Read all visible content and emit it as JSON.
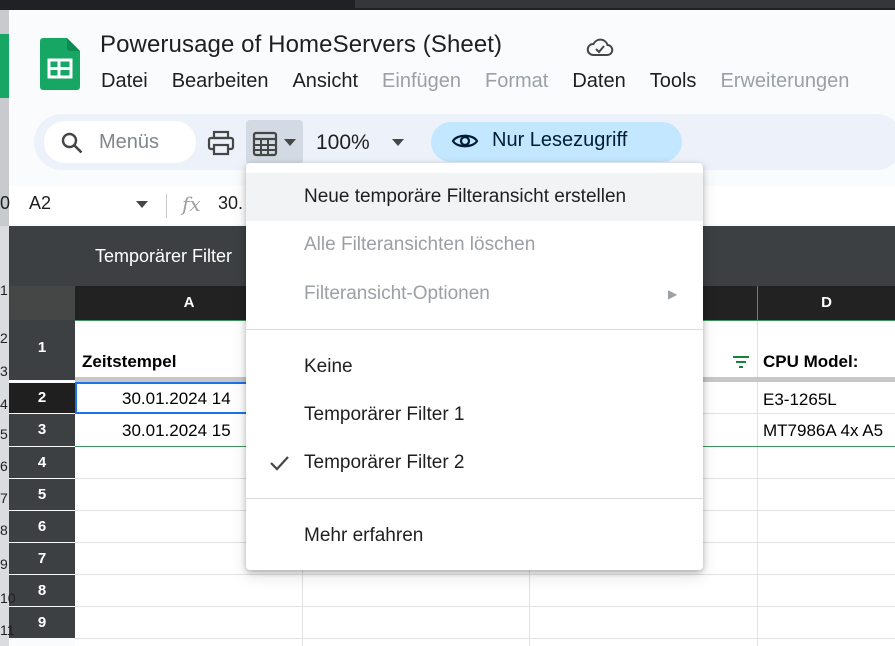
{
  "document": {
    "title": "Powerusage of HomeServers (Sheet)"
  },
  "menu_bar": [
    {
      "label": "Datei",
      "enabled": true
    },
    {
      "label": "Bearbeiten",
      "enabled": true
    },
    {
      "label": "Ansicht",
      "enabled": true
    },
    {
      "label": "Einfügen",
      "enabled": false
    },
    {
      "label": "Format",
      "enabled": false
    },
    {
      "label": "Daten",
      "enabled": true
    },
    {
      "label": "Tools",
      "enabled": true
    },
    {
      "label": "Erweiterungen",
      "enabled": false
    }
  ],
  "toolbar": {
    "search_placeholder": "Menüs",
    "zoom": "100%",
    "readonly_label": "Nur Lesezugriff"
  },
  "formula_bar": {
    "left_digit": "0",
    "cell_ref": "A2",
    "fx": "fx",
    "content": "30."
  },
  "filter_band": {
    "label": "Temporärer Filter"
  },
  "grid": {
    "columns": [
      "A",
      "D"
    ],
    "rows": [
      "1",
      "2",
      "3",
      "4",
      "5",
      "6",
      "7",
      "8",
      "9"
    ],
    "left_sliver_digits": [
      "1",
      "2",
      "3",
      "4",
      "5",
      "6",
      "7",
      "8",
      "9",
      "10",
      "11"
    ],
    "cells": {
      "A1": "Zeitstempel",
      "D1": "CPU Model:",
      "A2": "30.01.2024 14",
      "D2": "E3-1265L",
      "A3": "30.01.2024 15",
      "D3": "MT7986A 4x A5"
    }
  },
  "filter_menu": {
    "items": [
      {
        "label": "Neue temporäre Filteransicht erstellen",
        "enabled": true
      },
      {
        "label": "Alle Filteransichten löschen",
        "enabled": false
      },
      {
        "label": "Filteransicht-Optionen",
        "enabled": false,
        "submenu_arrow": "▶"
      },
      {
        "label": "Keine",
        "enabled": true
      },
      {
        "label": "Temporärer Filter 1",
        "enabled": true
      },
      {
        "label": "Temporärer Filter 2",
        "enabled": true,
        "checked": true
      },
      {
        "label": "Mehr erfahren",
        "enabled": true
      }
    ]
  },
  "colors": {
    "sheets_green": "#16a765",
    "readonly_pill": "#c2e7ff",
    "dark_band": "#3c4043",
    "header_black": "#222222"
  }
}
